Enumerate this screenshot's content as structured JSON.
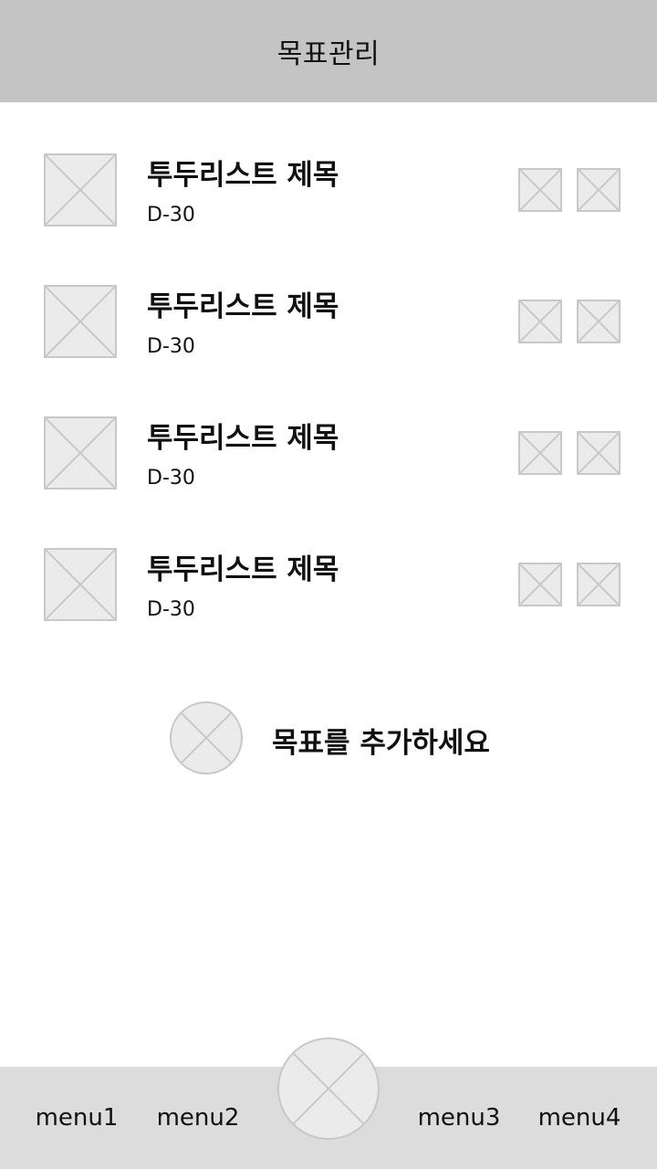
{
  "header": {
    "title": "목표관리"
  },
  "todos": [
    {
      "title": "투두리스트 제목",
      "dday": "D-30"
    },
    {
      "title": "투두리스트 제목",
      "dday": "D-30"
    },
    {
      "title": "투두리스트 제목",
      "dday": "D-30"
    },
    {
      "title": "투두리스트 제목",
      "dday": "D-30"
    }
  ],
  "add_goal": {
    "label": "목표를 추가하세요",
    "icon": "image-placeholder-icon"
  },
  "bottom_nav": {
    "items": [
      "menu1",
      "menu2",
      "menu3",
      "menu4"
    ],
    "center_icon": "image-placeholder-icon"
  },
  "colors": {
    "header_bg": "#c4c4c4",
    "nav_bg": "#dcdcdc",
    "placeholder_fill": "#ebebeb",
    "placeholder_stroke": "#c8c8c8"
  }
}
